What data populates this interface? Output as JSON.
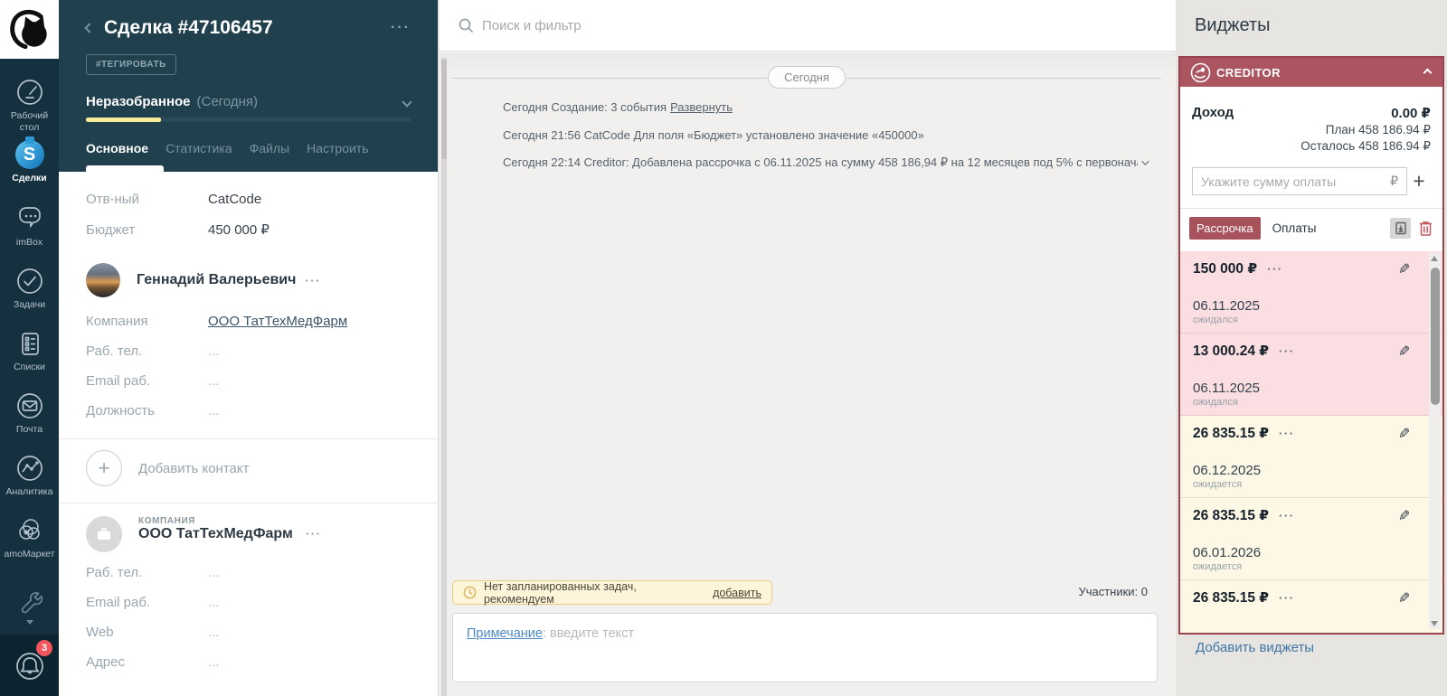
{
  "sidebar": {
    "items": [
      {
        "label": "Рабочий стол"
      },
      {
        "label": "Сделки"
      },
      {
        "label": "imBox"
      },
      {
        "label": "Задачи"
      },
      {
        "label": "Списки"
      },
      {
        "label": "Почта"
      },
      {
        "label": "Аналитика"
      },
      {
        "label": "amoМаркет"
      }
    ],
    "notifications_badge": "3"
  },
  "deal": {
    "title": "Сделка #47106457",
    "menu_dots": "···",
    "tag_button": "#ТЕГИРОВАТЬ",
    "stage": {
      "name": "Неразобранное",
      "period": "(Сегодня)",
      "progress_percent": 23
    },
    "tabs": [
      {
        "label": "Основное"
      },
      {
        "label": "Статистика"
      },
      {
        "label": "Файлы"
      },
      {
        "label": "Настроить"
      }
    ],
    "fields": [
      {
        "label": "Отв-ный",
        "value": "CatCode"
      },
      {
        "label": "Бюджет",
        "value": "450 000  ₽"
      }
    ],
    "contact": {
      "name": "Геннадий Валерьевич",
      "menu_dots": "···",
      "fields": [
        {
          "label": "Компания",
          "value": "ООО ТатТехМедФарм"
        },
        {
          "label": "Раб. тел.",
          "value": "..."
        },
        {
          "label": "Email раб.",
          "value": "..."
        },
        {
          "label": "Должность",
          "value": "..."
        }
      ]
    },
    "add_contact_label": "Добавить контакт",
    "company": {
      "type_label": "КОМПАНИЯ",
      "name": "ООО ТатТехМедФарм",
      "menu_dots": "···",
      "fields": [
        {
          "label": "Раб. тел.",
          "value": "..."
        },
        {
          "label": "Email раб.",
          "value": "..."
        },
        {
          "label": "Web",
          "value": "..."
        },
        {
          "label": "Адрес",
          "value": "..."
        }
      ]
    }
  },
  "feed": {
    "search_placeholder": "Поиск и фильтр",
    "day_divider": "Сегодня",
    "events": [
      {
        "text": "Сегодня Создание: 3 события",
        "link": "Развернуть"
      },
      {
        "text": "Сегодня 21:56 CatCode Для поля «Бюджет» установлено значение «450000»",
        "link": ""
      },
      {
        "text": "Сегодня 22:14 Creditor: Добавлена рассрочка с 06.11.2025 на сумму 458 186,94 ₽ на 12 месяцев под 5% с первонача",
        "link": ""
      }
    ],
    "task_banner": {
      "text": "Нет запланированных задач, рекомендуем",
      "link": "добавить"
    },
    "participants": "Участники: 0",
    "note": {
      "link": "Примечание",
      "placeholder": ": введите текст"
    }
  },
  "widgets": {
    "title": "Виджеты",
    "add_link": "Добавить виджеты",
    "creditor": {
      "name": "CREDITOR",
      "income_label": "Доход",
      "income_value": "0.00 ₽",
      "plan_line": "План 458 186.94 ₽",
      "remaining_line": "Осталось 458 186.94 ₽",
      "amount_placeholder": "Укажите сумму оплаты",
      "currency_suffix": "₽",
      "add_payment_label": "+",
      "tabs": [
        {
          "label": "Рассрочка"
        },
        {
          "label": "Оплаты"
        }
      ],
      "payments": [
        {
          "amount": "150 000 ₽",
          "dots": "···",
          "date": "06.11.2025",
          "status": "ожидался",
          "tone": "pink"
        },
        {
          "amount": "13 000.24 ₽",
          "dots": "···",
          "date": "06.11.2025",
          "status": "ожидался",
          "tone": "pink"
        },
        {
          "amount": "26 835.15 ₽",
          "dots": "···",
          "date": "06.12.2025",
          "status": "ожидается",
          "tone": "cream"
        },
        {
          "amount": "26 835.15 ₽",
          "dots": "···",
          "date": "06.01.2026",
          "status": "ожидается",
          "tone": "cream"
        },
        {
          "amount": "26 835.15 ₽",
          "dots": "···",
          "date": "",
          "status": "",
          "tone": "cream"
        }
      ]
    },
    "colors": {
      "accent_maroon": "#a8535c",
      "payment_pink": "#fbdee1",
      "payment_cream": "#fcf8e5",
      "progress_yellow": "#f7eb9b",
      "badge_red": "#f0545c",
      "link_blue": "#4176a4"
    }
  }
}
